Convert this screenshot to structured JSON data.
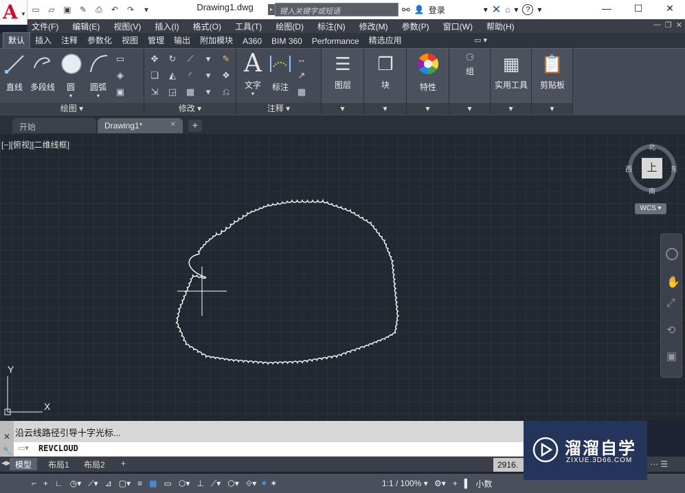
{
  "title_bar": {
    "app_logo": "A",
    "document_title": "Drawing1.dwg",
    "search_placeholder": "键入关键字或短语",
    "login_label": "登录"
  },
  "menu": [
    "文件(F)",
    "编辑(E)",
    "视图(V)",
    "插入(I)",
    "格式(O)",
    "工具(T)",
    "绘图(D)",
    "标注(N)",
    "修改(M)",
    "参数(P)",
    "窗口(W)",
    "帮助(H)"
  ],
  "ribbon_tabs": [
    "默认",
    "插入",
    "注释",
    "参数化",
    "视图",
    "管理",
    "输出",
    "附加模块",
    "A360",
    "BIM 360",
    "Performance",
    "精选应用"
  ],
  "active_ribbon_tab": "默认",
  "ribbon": {
    "draw": {
      "title": "绘图",
      "tools": [
        "直线",
        "多段线",
        "圆",
        "圆弧"
      ]
    },
    "modify": {
      "title": "修改"
    },
    "annotation": {
      "title": "注释",
      "tools": [
        "文字",
        "标注"
      ]
    },
    "layers": {
      "label": "图层"
    },
    "block": {
      "label": "块"
    },
    "properties": {
      "label": "特性"
    },
    "group": {
      "label": "组"
    },
    "utilities": {
      "label": "实用工具"
    },
    "clipboard": {
      "label": "剪贴板"
    }
  },
  "file_tabs": {
    "start": "开始",
    "drawing": "Drawing1*"
  },
  "viewport": {
    "label": "[−][俯视][二维线框]",
    "compass": {
      "north": "北",
      "south": "南",
      "east": "东",
      "west": "西",
      "top": "上"
    },
    "wcs": "WCS",
    "ucs_x": "X",
    "ucs_y": "Y"
  },
  "command": {
    "history": "沿云线路径引导十字光标...",
    "input": "REVCLOUD"
  },
  "layout_tabs": [
    "模型",
    "布局1",
    "布局2"
  ],
  "active_layout": "模型",
  "coords": "2916.",
  "status": {
    "scale": "1:1 / 100%",
    "unit": "小数"
  },
  "watermark": {
    "brand": "溜溜自学",
    "url": "ZIXUE.3D66.COM"
  }
}
